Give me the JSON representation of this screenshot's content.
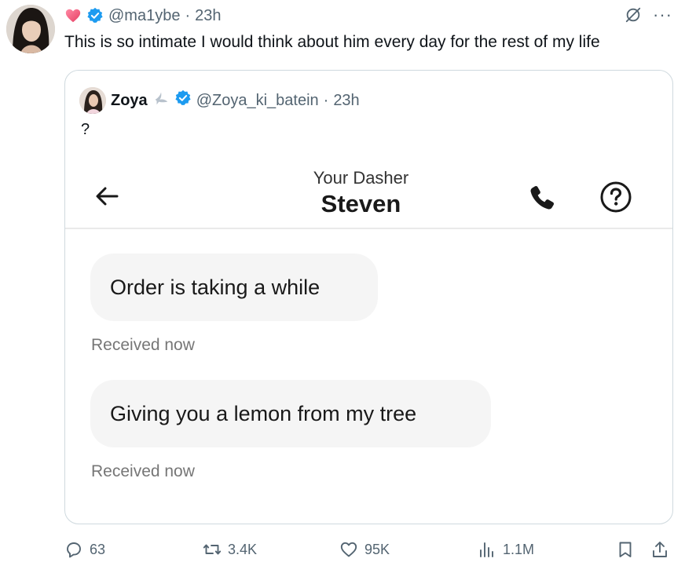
{
  "tweet": {
    "handle": "@ma1ybe",
    "separator": "·",
    "time": "23h",
    "text": "This is so intimate I would think about him every day for the rest of my life",
    "more": "···"
  },
  "quote": {
    "name": "Zoya",
    "handle": "@Zoya_ki_batein",
    "separator": "·",
    "time": "23h",
    "text": "?",
    "dasher_label": "Your Dasher",
    "dasher_name": "Steven",
    "messages": [
      {
        "text": "Order is taking a while",
        "status": "Received now"
      },
      {
        "text": "Giving you a lemon from my tree",
        "status": "Received now"
      }
    ]
  },
  "actions": {
    "replies": "63",
    "retweets": "3.4K",
    "likes": "95K",
    "views": "1.1M"
  },
  "colors": {
    "verified": "#1d9bf0",
    "heart": "#f4577a",
    "secondary_text": "#536471",
    "bubble": "#f5f5f5"
  },
  "icons": [
    "heart-icon",
    "verified-icon",
    "grok-icon",
    "more-icon",
    "back-arrow-icon",
    "phone-icon",
    "help-icon",
    "reply-icon",
    "retweet-icon",
    "like-icon",
    "views-icon",
    "bookmark-icon",
    "share-icon"
  ]
}
